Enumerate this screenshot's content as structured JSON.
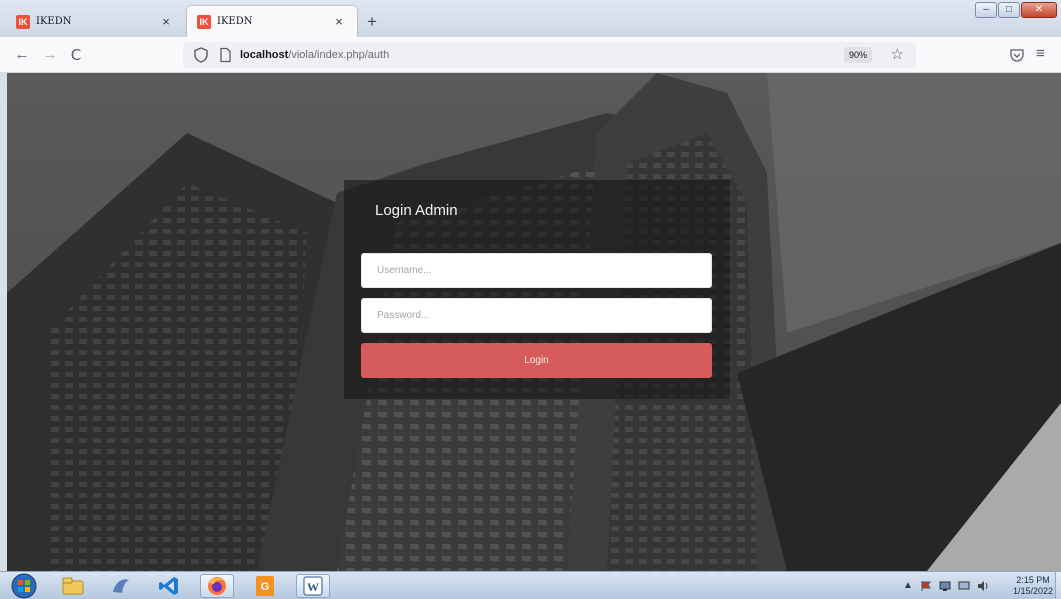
{
  "browser": {
    "tabs": [
      {
        "favicon_text": "IK",
        "title": "IKEDN",
        "close": "×",
        "active": false
      },
      {
        "favicon_text": "IK",
        "title": "IKEDN",
        "close": "×",
        "active": true
      }
    ],
    "new_tab": "+",
    "window_controls": {
      "minimize": "–",
      "maximize": "□",
      "close": "✕"
    },
    "nav": {
      "back": "←",
      "forward": "→",
      "reload": "C"
    },
    "address": {
      "host": "localhost",
      "path": "/viola/index.php/auth"
    },
    "zoom": "90%",
    "bookmark_star": "☆",
    "menu": "≡",
    "icons": [
      "shield-icon",
      "page-icon",
      "star-icon",
      "pocket-icon",
      "hamburger-menu-icon"
    ]
  },
  "login": {
    "title": "Login Admin",
    "username_placeholder": "Username...",
    "password_placeholder": "Password...",
    "button_label": "Login",
    "accent_color": "#d65b5b"
  },
  "taskbar": {
    "apps": [
      "start-orb",
      "file-explorer",
      "dolphin-app",
      "vscode",
      "firefox",
      "pdf-tool",
      "word"
    ],
    "tray_arrow": "▲",
    "time": "2:15 PM",
    "date": "1/15/2022"
  }
}
